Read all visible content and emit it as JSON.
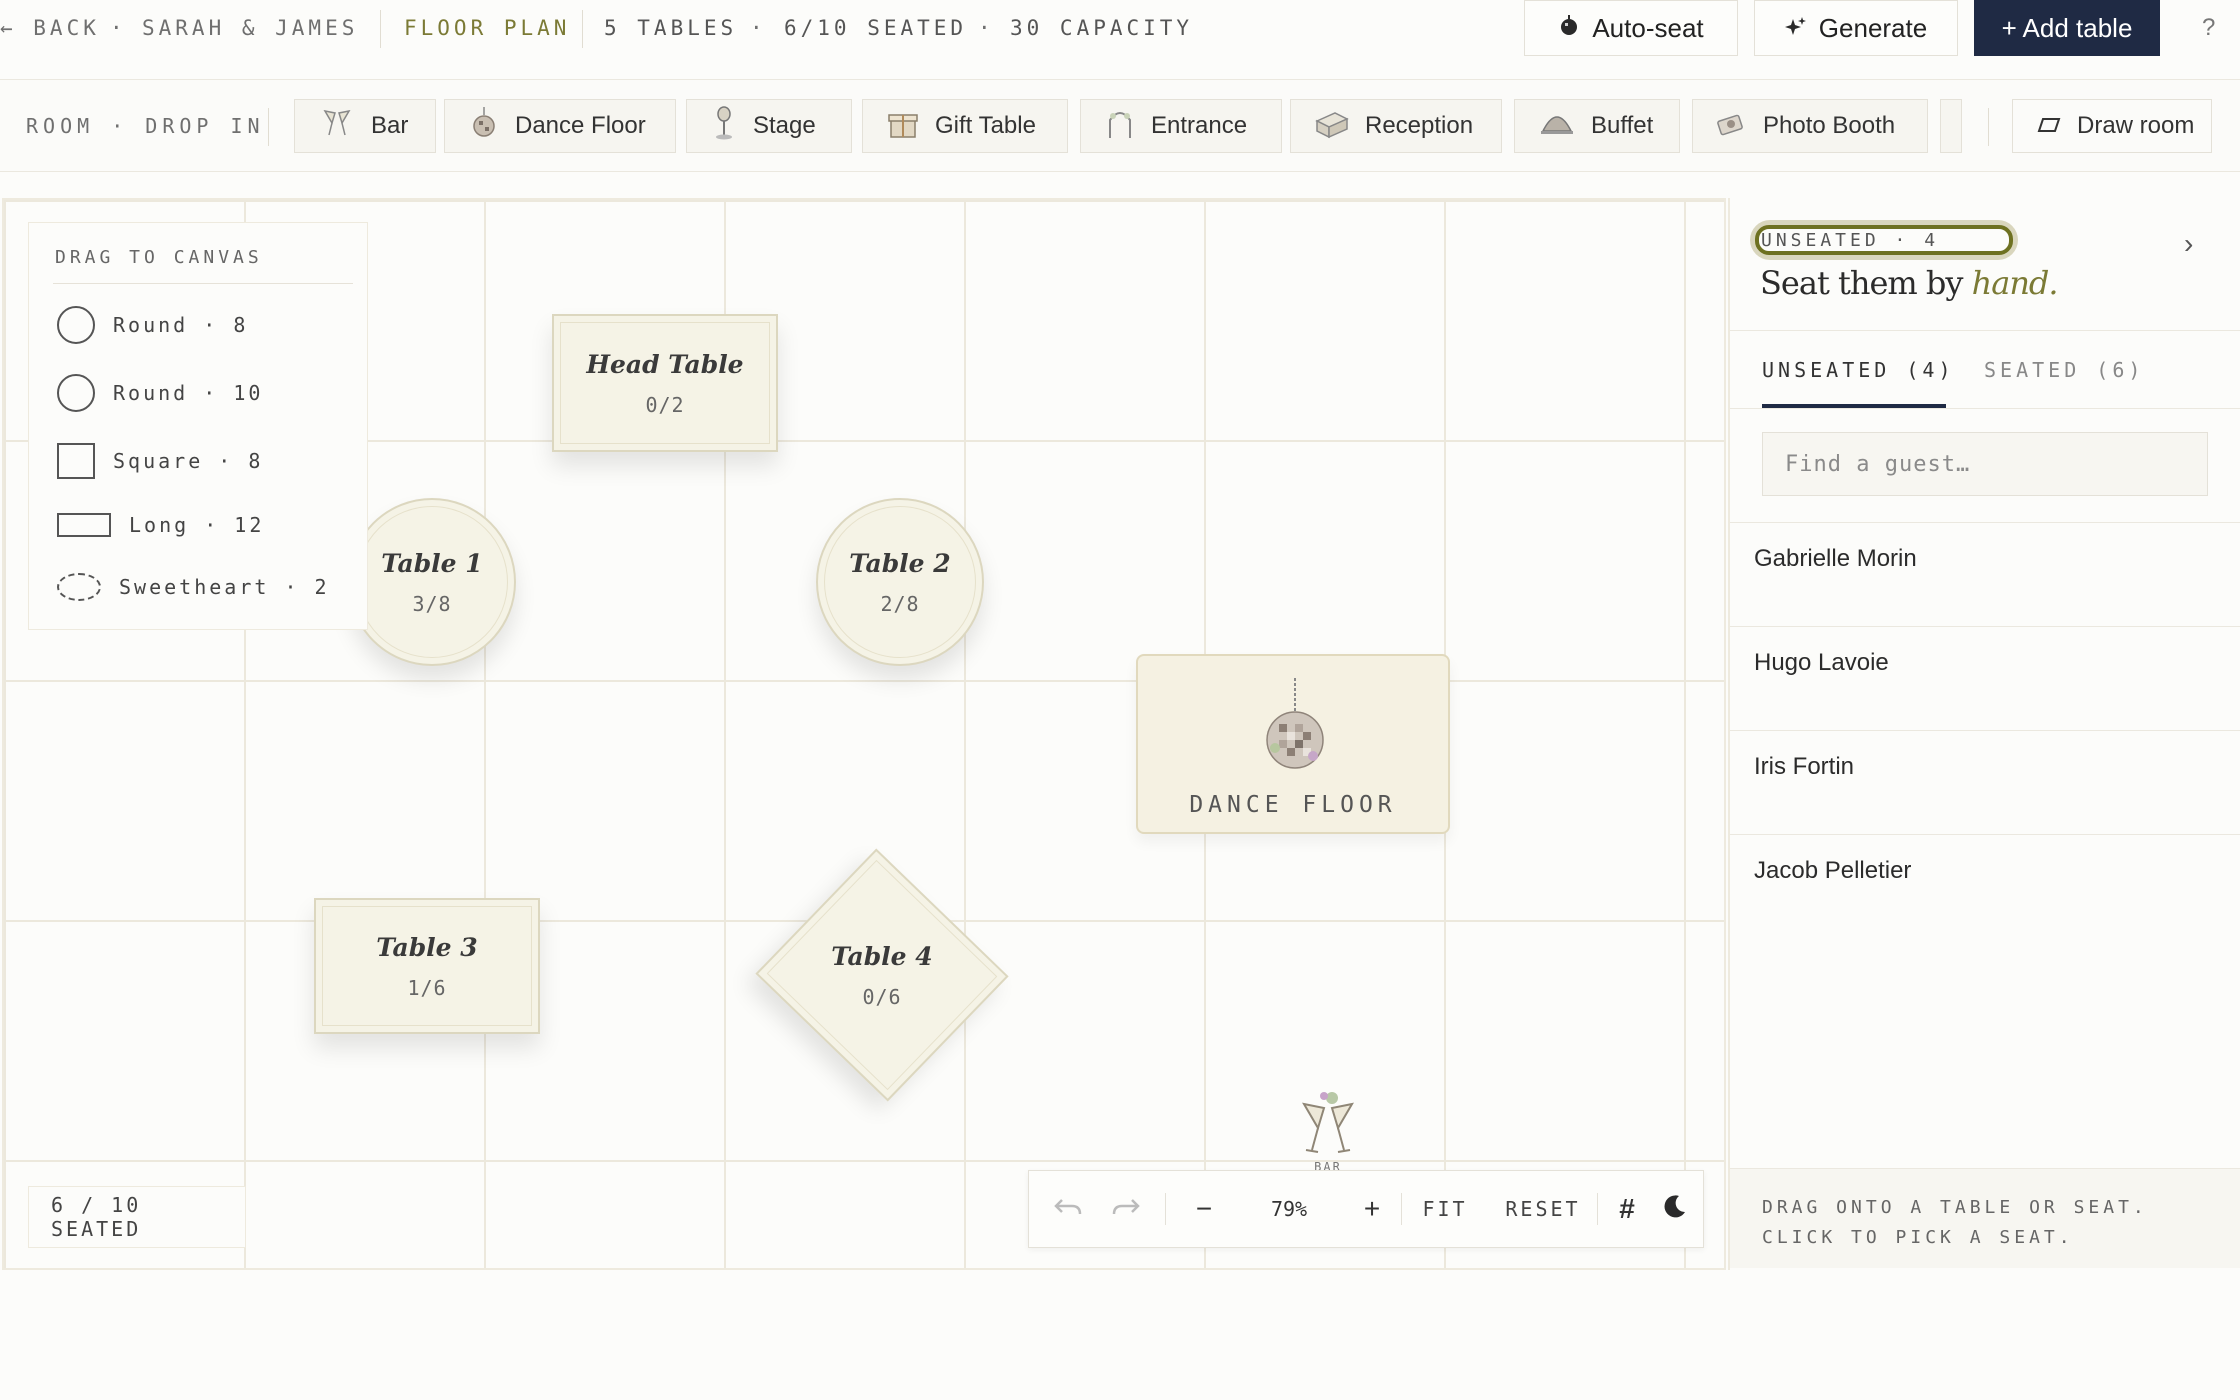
{
  "topbar": {
    "back_label": "← BACK",
    "dot": "·",
    "couple": "SARAH & JAMES",
    "section": "FLOOR PLAN",
    "tables_count": "5 TABLES",
    "seated_summary": "6/10 SEATED",
    "capacity": "30 CAPACITY",
    "autoseat_label": "Auto-seat",
    "generate_label": "Generate",
    "add_table_label": "+ Add table",
    "help_label": "?"
  },
  "elements_bar": {
    "label": "ROOM · DROP IN",
    "items": [
      {
        "label": "Bar",
        "icon": "champagne-glasses-icon"
      },
      {
        "label": "Dance Floor",
        "icon": "disco-ball-icon"
      },
      {
        "label": "Stage",
        "icon": "microphone-icon"
      },
      {
        "label": "Gift Table",
        "icon": "gift-box-icon"
      },
      {
        "label": "Entrance",
        "icon": "arch-icon"
      },
      {
        "label": "Reception",
        "icon": "reception-desk-icon"
      },
      {
        "label": "Buffet",
        "icon": "cloche-icon"
      },
      {
        "label": "Photo Booth",
        "icon": "camera-icon"
      }
    ],
    "draw_room_label": "Draw room"
  },
  "palette": {
    "title": "DRAG TO CANVAS",
    "items": [
      {
        "label": "Round · 8",
        "shape": "round"
      },
      {
        "label": "Round · 10",
        "shape": "round"
      },
      {
        "label": "Square · 8",
        "shape": "square"
      },
      {
        "label": "Long · 12",
        "shape": "long"
      },
      {
        "label": "Sweetheart · 2",
        "shape": "sweetheart"
      }
    ]
  },
  "tables": [
    {
      "name": "Head Table",
      "count": "0/2",
      "shape": "rect"
    },
    {
      "name": "Table 1",
      "count": "3/8",
      "shape": "round"
    },
    {
      "name": "Table 2",
      "count": "2/8",
      "shape": "round"
    },
    {
      "name": "Table 3",
      "count": "1/6",
      "shape": "rect"
    },
    {
      "name": "Table 4",
      "count": "0/6",
      "shape": "rect-rotated"
    }
  ],
  "room_elements": {
    "dance_floor_label": "DANCE FLOOR",
    "bar_label": "BAR"
  },
  "canvas": {
    "seated_count": "6 / 10 SEATED"
  },
  "zoom": {
    "value": "79%",
    "minus": "−",
    "plus": "+",
    "fit_label": "FIT",
    "reset_label": "RESET",
    "grid_label": "#"
  },
  "panel": {
    "badge": "UNSEATED · 4",
    "title_pre": "Seat them by ",
    "title_em": "hand.",
    "tab_unseated": "UNSEATED (4)",
    "tab_seated": "SEATED (6)",
    "search_placeholder": "Find a guest…",
    "guests": [
      "Gabrielle Morin",
      "Hugo Lavoie",
      "Iris Fortin",
      "Jacob Pelletier"
    ],
    "footer_line1": "DRAG ONTO A TABLE OR SEAT.",
    "footer_line2": "CLICK TO PICK A SEAT."
  },
  "colors": {
    "accent": "#7b7a35",
    "primary": "#1f2a44",
    "table_fill": "#f5f3e6",
    "grid": "#ece8dc"
  }
}
